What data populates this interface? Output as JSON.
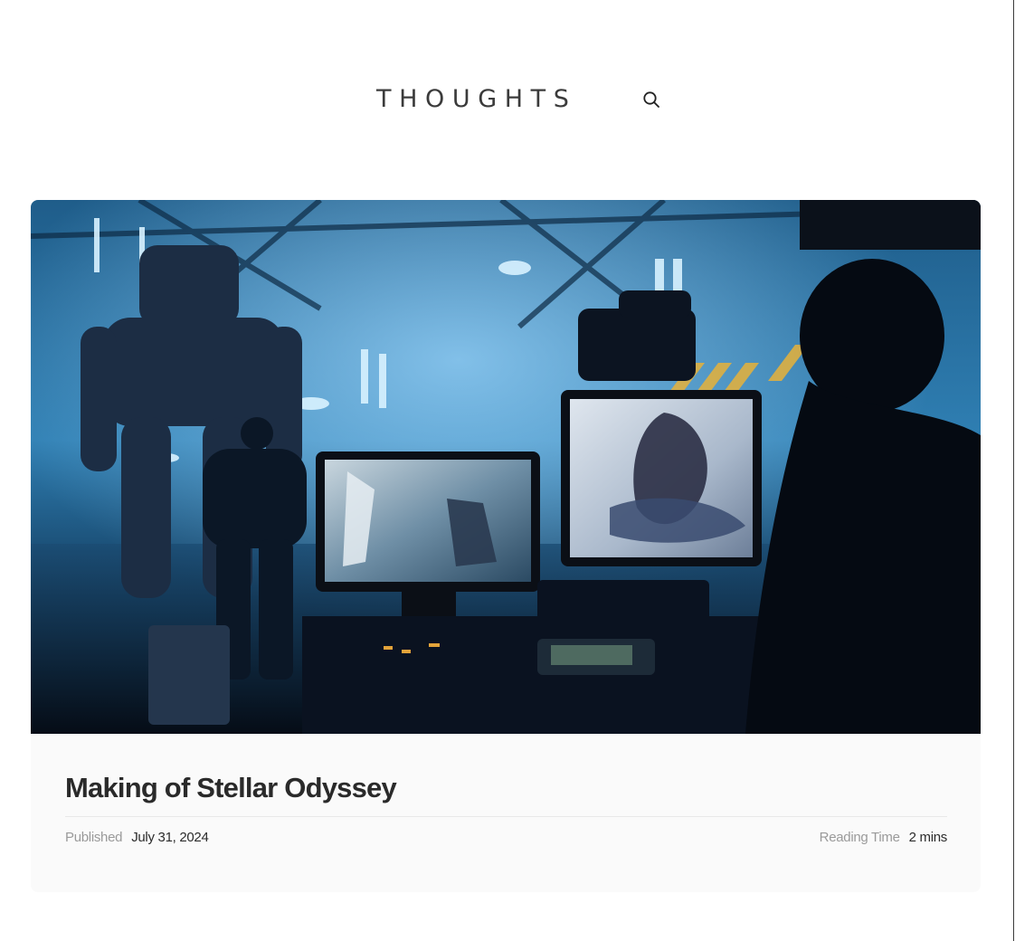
{
  "header": {
    "site_title": "THOUGHTS",
    "search_icon": "search-icon"
  },
  "post": {
    "image_alt": "film production studio with robots and monitors",
    "title": "Making of Stellar Odyssey",
    "published_label": "Published",
    "published_date": "July 31, 2024",
    "reading_time_label": "Reading Time",
    "reading_time_value": "2 mins"
  },
  "colors": {
    "background": "#ffffff",
    "card_background": "#fafafa",
    "title_text": "#2a2a2a",
    "meta_label": "#9a9a9a",
    "divider": "#e8e8e8"
  }
}
